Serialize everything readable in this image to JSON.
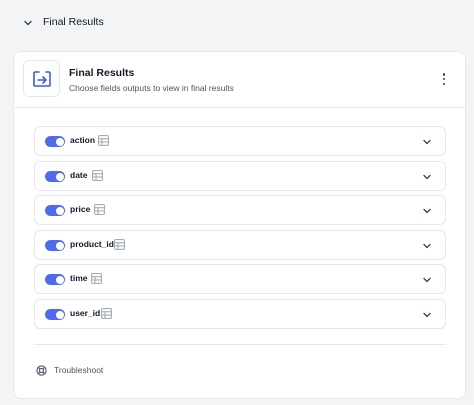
{
  "section": {
    "title": "Final Results"
  },
  "node": {
    "title": "Final Results",
    "subtitle": "Choose fields outputs to view in final results",
    "icon": "output-arrow-icon"
  },
  "fields": [
    {
      "name": "action",
      "enabled": true
    },
    {
      "name": "date",
      "enabled": true
    },
    {
      "name": "price",
      "enabled": true
    },
    {
      "name": "product_id",
      "enabled": true
    },
    {
      "name": "time",
      "enabled": true
    },
    {
      "name": "user_id",
      "enabled": true
    }
  ],
  "troubleshoot": {
    "label": "Troubleshoot",
    "icon": "lifebuoy-icon"
  },
  "colors": {
    "accent": "#4f6bed",
    "border": "#e5e7eb",
    "icon_blue": "#3b5bdb"
  }
}
